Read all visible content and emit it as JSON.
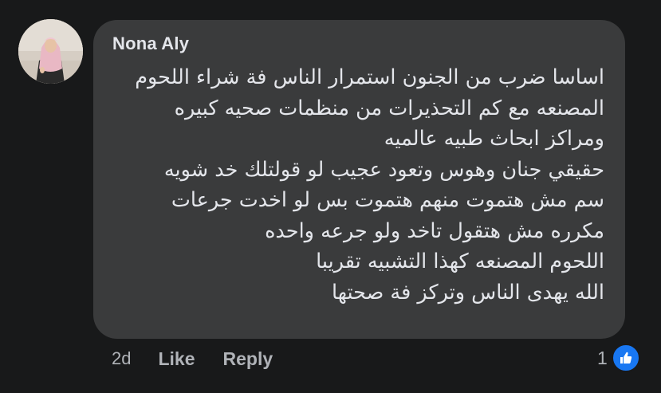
{
  "comment": {
    "author": "Nona Aly",
    "lines": [
      "اساسا ضرب من الجنون استمرار الناس فة شراء اللحوم",
      "المصنعه مع كم التحذيرات من منظمات صحيه كبيره",
      "ومراكز ابحاث طبيه عالميه",
      "حقيقي جنان وهوس وتعود عجيب لو قولتلك خد شويه",
      "سم مش هتموت منهم هتموت بس لو اخدت جرعات",
      "مكرره مش هتقول تاخد ولو جرعه واحده",
      "اللحوم المصنعه كهذا التشبيه تقريبا",
      "الله يهدى الناس وتركز فة صحتها"
    ],
    "bubble_color": "#3a3b3c",
    "text_color": "#e4e6eb"
  },
  "actions": {
    "time": "2d",
    "like_label": "Like",
    "reply_label": "Reply"
  },
  "reactions": {
    "count": "1",
    "icon": "thumbs-up-icon",
    "badge_color": "#1877f2"
  },
  "avatar": {
    "icon": "profile-photo"
  }
}
